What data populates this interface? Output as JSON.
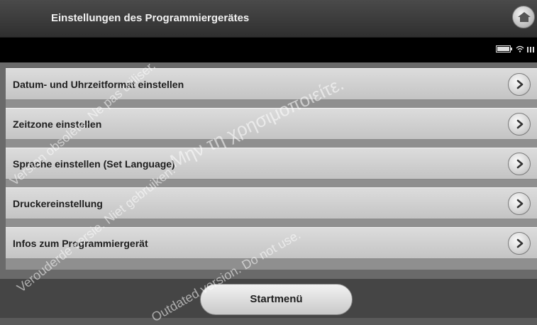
{
  "header": {
    "title": "Einstellungen des Programmiergerätes",
    "home_icon": "home-icon"
  },
  "status": {
    "icons": [
      "battery-icon",
      "wifi-icon",
      "signal-icon"
    ]
  },
  "menu": {
    "items": [
      {
        "label": "Datum- und Uhrzeitformat einstellen"
      },
      {
        "label": "Zeitzone einstellen"
      },
      {
        "label": "Sprache einstellen (Set Language)"
      },
      {
        "label": "Druckereinstellung"
      },
      {
        "label": "Infos zum Programmiergerät"
      }
    ]
  },
  "footer": {
    "start_label": "Startmenü"
  },
  "watermarks": [
    "Μην τη χρησιμοποιείτε.",
    "Version obsolète. Ne pas utiliser.",
    "Verouderde versie. Niet gebruiken.",
    "Outdated version. Do not use."
  ],
  "colors": {
    "titlebar": "#3a3a3a",
    "statusbar": "#000000",
    "item": "#d0d0d0",
    "text": "#1e1e1e"
  }
}
